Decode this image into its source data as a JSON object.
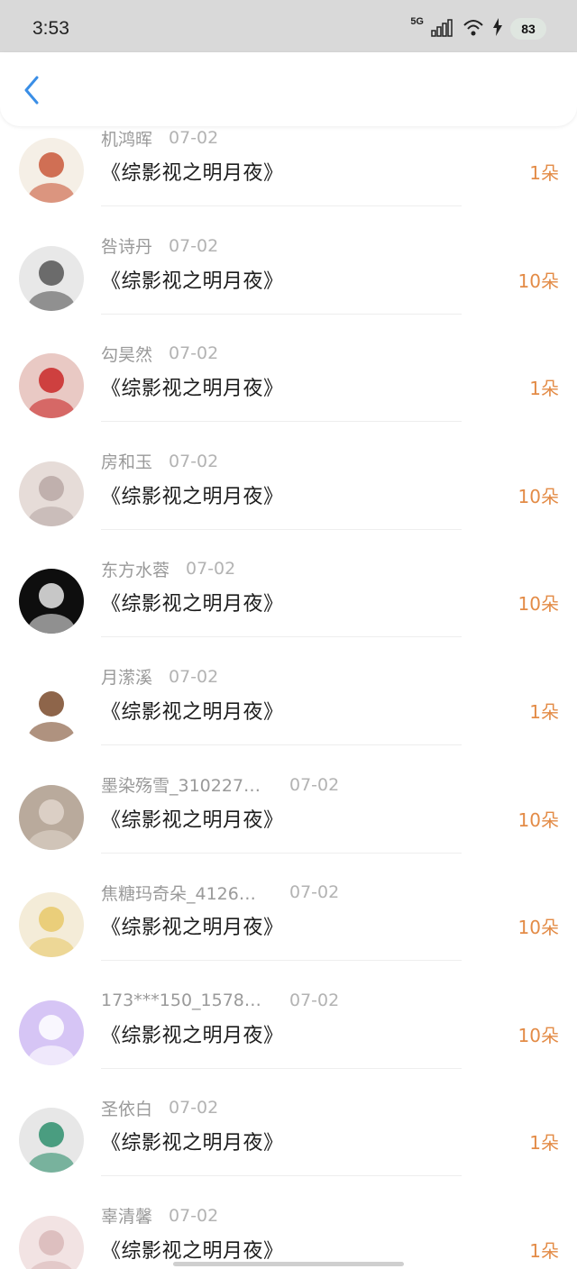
{
  "status": {
    "time": "3:53",
    "network": "5G",
    "battery": "83"
  },
  "rows": [
    {
      "name": "机鸿晖",
      "date": "07-02",
      "title": "《综影视之明月夜》",
      "amount": "1朵",
      "avatar_bg": "#f5efe6",
      "avatar_fg": "#c9583a"
    },
    {
      "name": "咎诗丹",
      "date": "07-02",
      "title": "《综影视之明月夜》",
      "amount": "10朵",
      "avatar_bg": "#e8e8e8",
      "avatar_fg": "#555555"
    },
    {
      "name": "勾昊然",
      "date": "07-02",
      "title": "《综影视之明月夜》",
      "amount": "1朵",
      "avatar_bg": "#e9c9c4",
      "avatar_fg": "#c92828"
    },
    {
      "name": "房和玉",
      "date": "07-02",
      "title": "《综影视之明月夜》",
      "amount": "10朵",
      "avatar_bg": "#e6dcd8",
      "avatar_fg": "#b8a8a6"
    },
    {
      "name": "东方水蓉",
      "date": "07-02",
      "title": "《综影视之明月夜》",
      "amount": "10朵",
      "avatar_bg": "#0e0e0e",
      "avatar_fg": "#e8e8e8"
    },
    {
      "name": "月潆溪",
      "date": "07-02",
      "title": "《综影视之明月夜》",
      "amount": "1朵",
      "avatar_bg": "#ffffff",
      "avatar_fg": "#7a4a2a"
    },
    {
      "name": "墨染殇雪_310227…",
      "date": "07-02",
      "title": "《综影视之明月夜》",
      "amount": "10朵",
      "avatar_bg": "#b9aa9c",
      "avatar_fg": "#e0d6cc"
    },
    {
      "name": "焦糖玛奇朵_4126…",
      "date": "07-02",
      "title": "《综影视之明月夜》",
      "amount": "10朵",
      "avatar_bg": "#f4ecd8",
      "avatar_fg": "#e8c96a"
    },
    {
      "name": "173***150_1578…",
      "date": "07-02",
      "title": "《综影视之明月夜》",
      "amount": "10朵",
      "avatar_bg": "#d6c5f5",
      "avatar_fg": "#ffffff"
    },
    {
      "name": "圣依白",
      "date": "07-02",
      "title": "《综影视之明月夜》",
      "amount": "1朵",
      "avatar_bg": "#e7e7e7",
      "avatar_fg": "#2e8f6d"
    },
    {
      "name": "辜清馨",
      "date": "07-02",
      "title": "《综影视之明月夜》",
      "amount": "1朵",
      "avatar_bg": "#f2e3e3",
      "avatar_fg": "#d9b8b8"
    }
  ],
  "colors": {
    "accent_blue": "#3a8ee6",
    "amount_orange": "#e38b46"
  }
}
